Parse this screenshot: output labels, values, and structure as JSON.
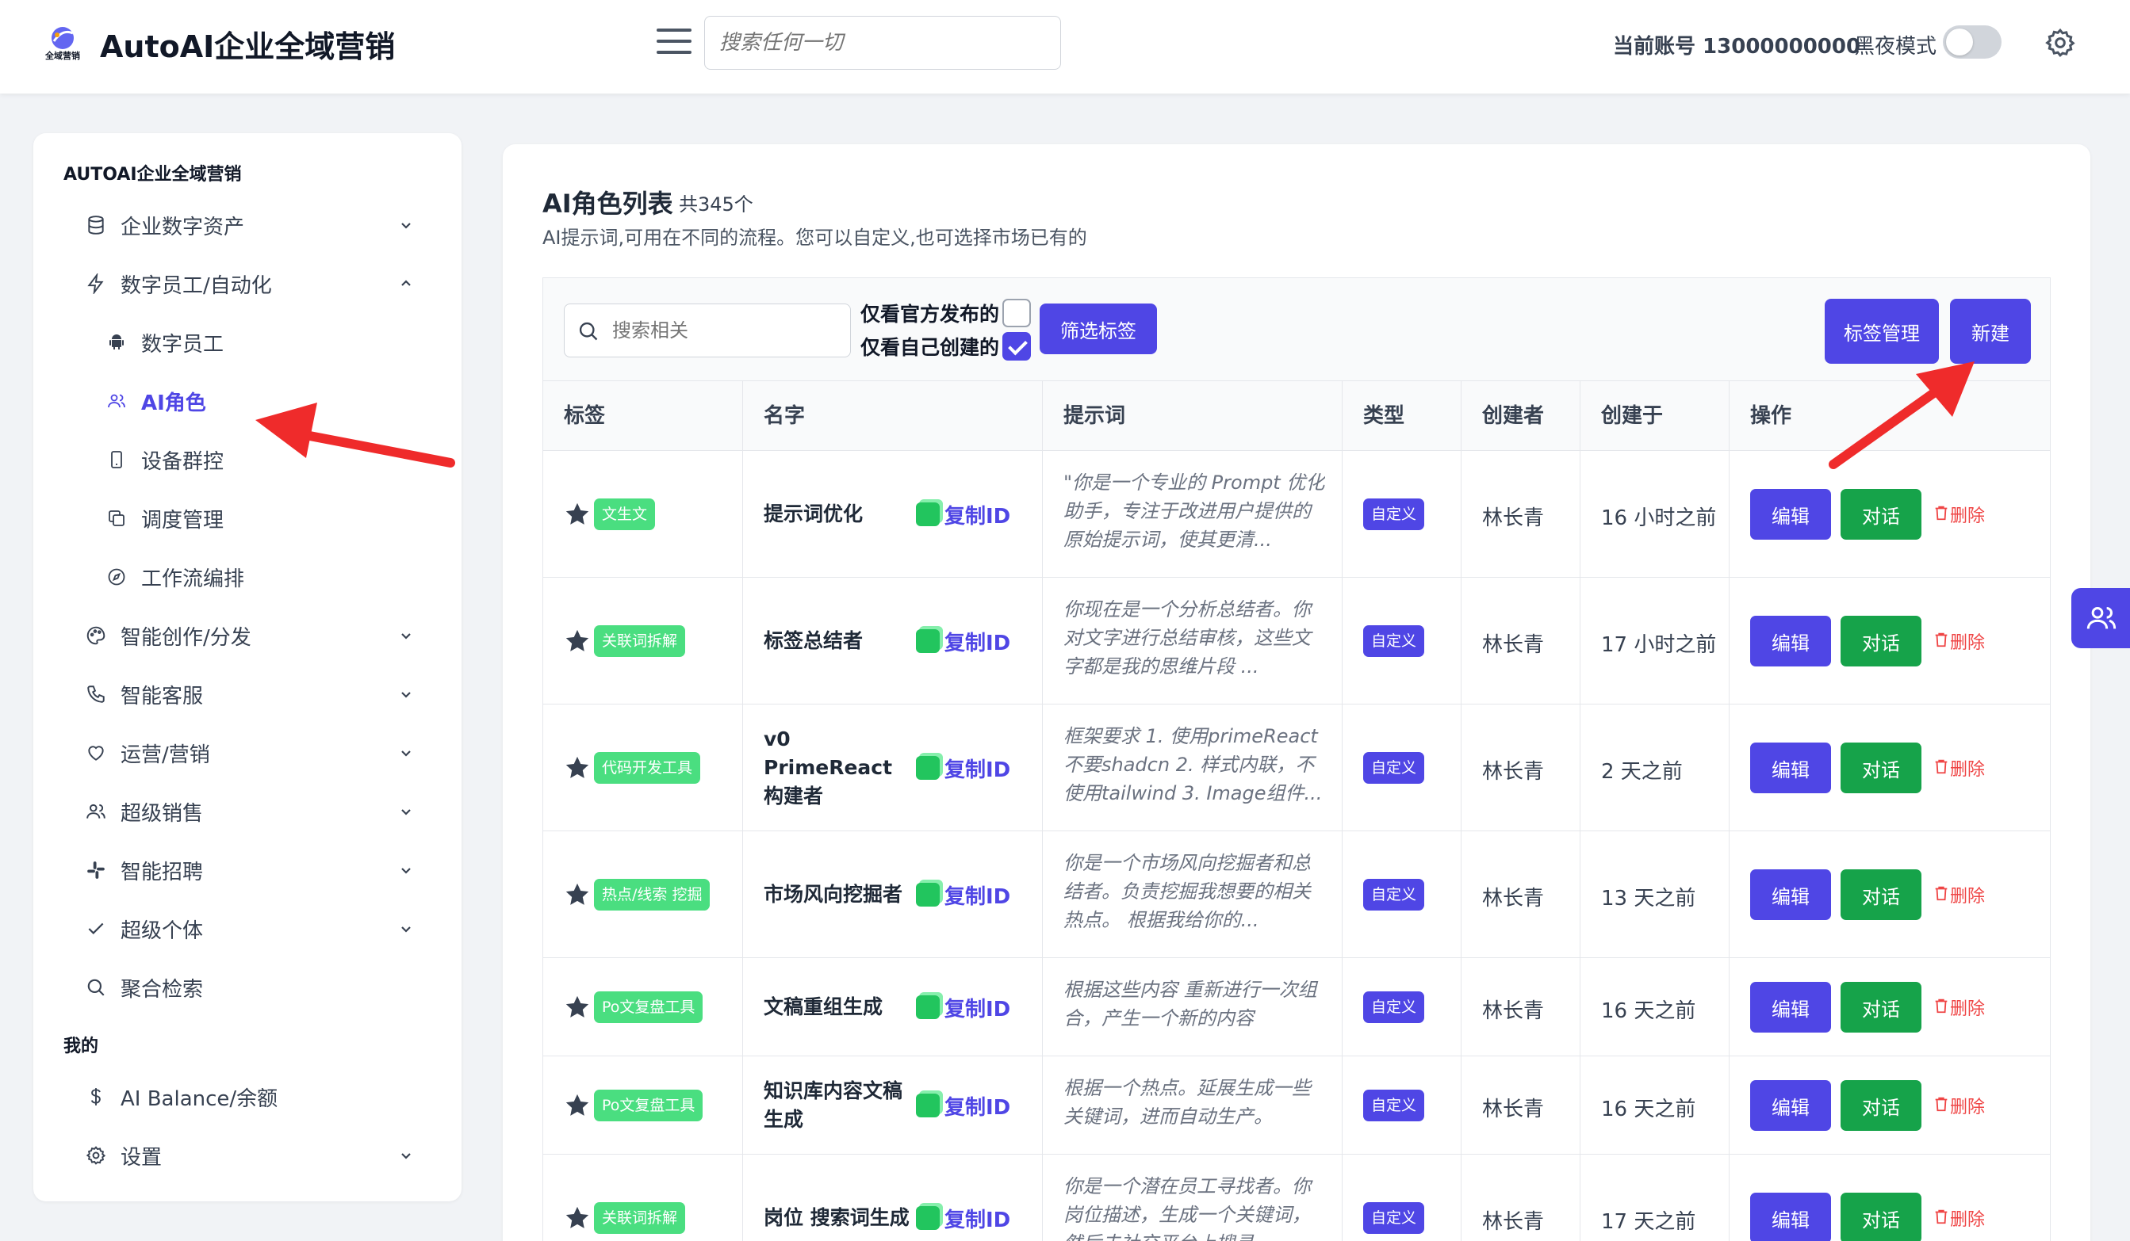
{
  "header": {
    "logo_text": "全域营销",
    "app_title": "AutoAI企业全域营销",
    "search_placeholder": "搜索任何一切",
    "account_label": "当前账号 13000000000",
    "dark_mode_label": "黑夜模式"
  },
  "sidebar": {
    "section_title": "AUTOAI企业全域营销",
    "items": [
      {
        "label": "企业数字资产",
        "icon": "database-icon"
      },
      {
        "label": "数字员工/自动化",
        "icon": "lightning-icon"
      },
      {
        "label": "智能创作/分发",
        "icon": "palette-icon"
      },
      {
        "label": "智能客服",
        "icon": "phone-icon"
      },
      {
        "label": "运营/营销",
        "icon": "heart-icon"
      },
      {
        "label": "超级销售",
        "icon": "users-icon"
      },
      {
        "label": "智能招聘",
        "icon": "slack-icon"
      },
      {
        "label": "超级个体",
        "icon": "check-icon"
      },
      {
        "label": "聚合检索",
        "icon": "search-icon"
      }
    ],
    "sub_items": [
      {
        "label": "数字员工",
        "icon": "android-icon"
      },
      {
        "label": "AI角色",
        "icon": "users-icon",
        "active": true
      },
      {
        "label": "设备群控",
        "icon": "mobile-icon"
      },
      {
        "label": "调度管理",
        "icon": "copy-icon"
      },
      {
        "label": "工作流编排",
        "icon": "compass-icon"
      }
    ],
    "my_section_title": "我的",
    "my_items": [
      {
        "label": "AI Balance/余额",
        "icon": "dollar-icon"
      },
      {
        "label": "设置",
        "icon": "gear-icon"
      }
    ]
  },
  "main": {
    "title": "AI角色列表",
    "count": "共345个",
    "description": "AI提示词,可用在不同的流程。您可以自定义,也可选择市场已有的",
    "toolbar": {
      "search_placeholder": "搜索相关",
      "official_only_label": "仅看官方发布的",
      "official_only_checked": false,
      "mine_only_label": "仅看自己创建的",
      "mine_only_checked": true,
      "filter_button": "筛选标签",
      "tag_manage_button": "标签管理",
      "new_button": "新建"
    },
    "columns": [
      "标签",
      "名字",
      "提示词",
      "类型",
      "创建者",
      "创建于",
      "操作"
    ],
    "copy_id_label": "复制ID",
    "edit_label": "编辑",
    "chat_label": "对话",
    "delete_label": "删除",
    "rows": [
      {
        "tag": "文生文",
        "name": "提示词优化",
        "prompt": "\"你是一个专业的 Prompt 优化助手，专注于改进用户提供的原始提示词，使其更清...",
        "type": "自定义",
        "creator": "林长青",
        "created": "16 小时之前"
      },
      {
        "tag": "关联词拆解",
        "name": "标签总结者",
        "prompt": "你现在是一个分析总结者。你对文字进行总结审核，这些文字都是我的思维片段 ...",
        "type": "自定义",
        "creator": "林长青",
        "created": "17 小时之前"
      },
      {
        "tag": "代码开发工具",
        "name": "v0 PrimeReact构建者",
        "prompt": "框架要求 1. 使用primeReact 不要shadcn 2. 样式内联，不使用tailwind 3. Image组件...",
        "type": "自定义",
        "creator": "林长青",
        "created": "2 天之前"
      },
      {
        "tag": "热点/线索 挖掘",
        "name": "市场风向挖掘者",
        "prompt": "你是一个市场风向挖掘者和总结者。负责挖掘我想要的相关热点。 根据我给你的...",
        "type": "自定义",
        "creator": "林长青",
        "created": "13 天之前"
      },
      {
        "tag": "Po文复盘工具",
        "name": "文稿重组生成",
        "prompt": "根据这些内容 重新进行一次组合，产生一个新的内容",
        "type": "自定义",
        "creator": "林长青",
        "created": "16 天之前"
      },
      {
        "tag": "Po文复盘工具",
        "name": "知识库内容文稿生成",
        "prompt": "根据一个热点。延展生成一些关键词，进而自动生产。",
        "type": "自定义",
        "creator": "林长青",
        "created": "16 天之前"
      },
      {
        "tag": "关联词拆解",
        "name": "岗位 搜索词生成",
        "prompt": "你是一个潜在员工寻找者。你岗位描述，生成一个关键词，然后去社交平台上搜寻...",
        "type": "自定义",
        "creator": "林长青",
        "created": "17 天之前"
      }
    ]
  },
  "colors": {
    "accent": "#4f46e5",
    "success": "#16a34a",
    "tag_green": "#4ade80",
    "danger": "#ef4444",
    "annotation_arrow": "#ef2b2b"
  }
}
